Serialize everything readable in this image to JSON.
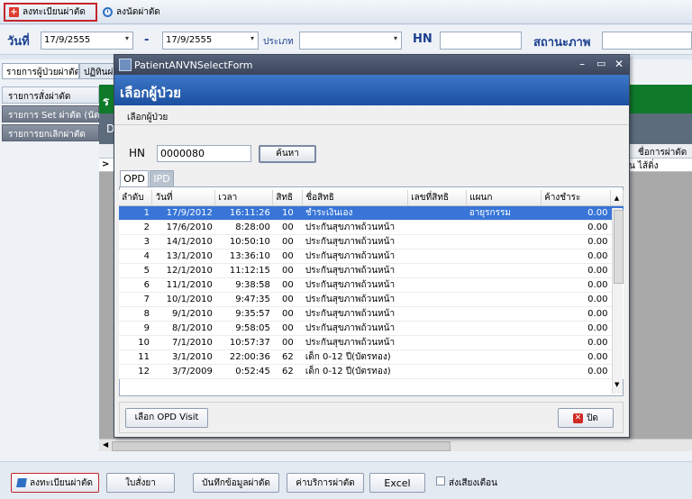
{
  "toolbar": {
    "register_label": "ลงทะเบียนผ่าตัด",
    "schedule_label": "ลงนัดผ่าตัด"
  },
  "filter": {
    "date_label": "วันที่",
    "date_from": "17/9/2555",
    "dash": "-",
    "date_to": "17/9/2555",
    "type_label": "ประเภท",
    "type_value": "",
    "hn_label": "HN",
    "hn_value": "",
    "status_label": "สถานะภาพ"
  },
  "left": {
    "tab1": "รายการผู้ป่วยผ่าตัด",
    "tab2": "ปฏิทินผ่าตัด",
    "btn_orders": "รายการสั่งผ่าตัด",
    "btn_set": "รายการ Set ผ่าตัด (นัด)",
    "btn_cancel": "รายการยกเลิกผ่าตัด"
  },
  "bg_grid": {
    "letter_green": "ร",
    "letter_d": "D",
    "col_header": "ชื่อการผ่าตัด",
    "row_value": "น ไส้ติ่ง",
    "row_marker": ">"
  },
  "modal": {
    "window_title": "PatientANVNSelectForm",
    "header": "เลือกผู้ป่วย",
    "subheader": "เลือกผู้ป่วย",
    "hn_label": "HN",
    "hn_value": "0000080",
    "search_button": "ค้นหา",
    "tabs": [
      "OPD",
      "IPD"
    ],
    "columns": [
      "ลำดับ",
      "วันที่",
      "เวลา",
      "สิทธิ",
      "ชื่อสิทธิ",
      "เลขที่สิทธิ",
      "แผนก",
      "ค้างชำระ"
    ],
    "rows": [
      {
        "no": "1",
        "date": "17/9/2012",
        "time": "16:11:26",
        "right": "10",
        "right_name": "ชำระเงินเอง",
        "right_no": "",
        "dept": "อายุรกรรม",
        "owed": "0.00"
      },
      {
        "no": "2",
        "date": "17/6/2010",
        "time": "8:28:00",
        "right": "00",
        "right_name": "ประกันสุขภาพถ้วนหน้า",
        "right_no": "",
        "dept": "",
        "owed": "0.00"
      },
      {
        "no": "3",
        "date": "14/1/2010",
        "time": "10:50:10",
        "right": "00",
        "right_name": "ประกันสุขภาพถ้วนหน้า",
        "right_no": "",
        "dept": "",
        "owed": "0.00"
      },
      {
        "no": "4",
        "date": "13/1/2010",
        "time": "13:36:10",
        "right": "00",
        "right_name": "ประกันสุขภาพถ้วนหน้า",
        "right_no": "",
        "dept": "",
        "owed": "0.00"
      },
      {
        "no": "5",
        "date": "12/1/2010",
        "time": "11:12:15",
        "right": "00",
        "right_name": "ประกันสุขภาพถ้วนหน้า",
        "right_no": "",
        "dept": "",
        "owed": "0.00"
      },
      {
        "no": "6",
        "date": "11/1/2010",
        "time": "9:38:58",
        "right": "00",
        "right_name": "ประกันสุขภาพถ้วนหน้า",
        "right_no": "",
        "dept": "",
        "owed": "0.00"
      },
      {
        "no": "7",
        "date": "10/1/2010",
        "time": "9:47:35",
        "right": "00",
        "right_name": "ประกันสุขภาพถ้วนหน้า",
        "right_no": "",
        "dept": "",
        "owed": "0.00"
      },
      {
        "no": "8",
        "date": "9/1/2010",
        "time": "9:35:57",
        "right": "00",
        "right_name": "ประกันสุขภาพถ้วนหน้า",
        "right_no": "",
        "dept": "",
        "owed": "0.00"
      },
      {
        "no": "9",
        "date": "8/1/2010",
        "time": "9:58:05",
        "right": "00",
        "right_name": "ประกันสุขภาพถ้วนหน้า",
        "right_no": "",
        "dept": "",
        "owed": "0.00"
      },
      {
        "no": "10",
        "date": "7/1/2010",
        "time": "10:57:37",
        "right": "00",
        "right_name": "ประกันสุขภาพถ้วนหน้า",
        "right_no": "",
        "dept": "",
        "owed": "0.00"
      },
      {
        "no": "11",
        "date": "3/1/2010",
        "time": "22:00:36",
        "right": "62",
        "right_name": "เด็ก 0-12 ปี(บัตรทอง)",
        "right_no": "",
        "dept": "",
        "owed": "0.00"
      },
      {
        "no": "12",
        "date": "3/7/2009",
        "time": "0:52:45",
        "right": "62",
        "right_name": "เด็ก 0-12 ปี(บัตรทอง)",
        "right_no": "",
        "dept": "",
        "owed": "0.00"
      }
    ],
    "select_visit_button": "เลือก OPD Visit",
    "close_button": "ปิด"
  },
  "bottom": {
    "register_label": "ลงทะเบียนผ่าตัด",
    "prescription_label": "ใบสั่งยา",
    "save_data_label": "บันทึกข้อมูลผ่าตัด",
    "fee_label": "ค่าบริการผ่าตัด",
    "excel_label": "Excel",
    "sound_alert_label": "ส่งเสียงเตือน"
  },
  "colors": {
    "highlight_red": "#c4252c",
    "title_blue": "#1c4f9f",
    "selected_row": "#3875d7"
  }
}
